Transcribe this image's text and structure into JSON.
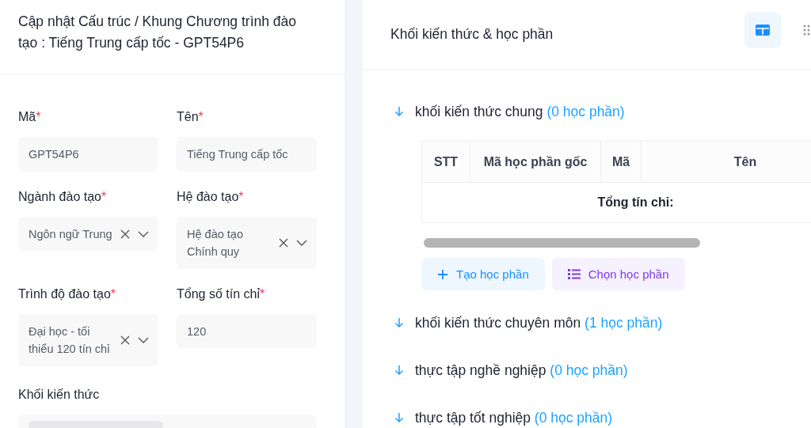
{
  "form": {
    "title": "Cập nhật Cấu trúc / Khung Chương trình đào tạo : Tiếng Trung cấp tốc - GPT54P6",
    "fields": [
      {
        "label": "Mã",
        "required_mark": "*",
        "kind": "text",
        "value": "GPT54P6"
      },
      {
        "label": "Tên",
        "required_mark": "*",
        "kind": "text",
        "value": "Tiếng Trung cấp tốc"
      },
      {
        "label": "Ngành đào tạo",
        "required_mark": "*",
        "kind": "select",
        "value": "Ngôn ngữ Trung"
      },
      {
        "label": "Hệ đào tạo",
        "required_mark": "*",
        "kind": "select",
        "value": "Hệ đào tạo Chính quy"
      },
      {
        "label": "Trình độ đào tạo",
        "required_mark": "*",
        "kind": "select",
        "value": "Đại học - tối thiểu 120 tín chỉ"
      },
      {
        "label": "Tổng số tín chỉ",
        "required_mark": "*",
        "kind": "text",
        "value": "120"
      },
      {
        "label": "Khối kiến thức",
        "kind": "tags"
      }
    ]
  },
  "panel": {
    "title": "Khối kiến thức & học phần",
    "view_buttons": [
      {
        "kind": "table",
        "selected": true
      },
      {
        "kind": "grid",
        "selected": false
      }
    ],
    "sections": [
      {
        "name": "khối kiến thức chung",
        "count": "(0 học phần)",
        "expanded": true,
        "table": {
          "columns": [
            "STT",
            "Mã học phần gốc",
            "Mã",
            "Tên"
          ],
          "footer": "Tổng tín chỉ:"
        },
        "buttons": [
          {
            "kind": "create",
            "label": "Tạo học phần"
          },
          {
            "kind": "choose",
            "label": "Chọn học phần"
          }
        ]
      },
      {
        "name": "khối kiến thức chuyên môn",
        "count": "(1 học phần)",
        "expanded": false
      },
      {
        "name": "thực tập nghề nghiệp",
        "count": "(0 học phần)",
        "expanded": false
      },
      {
        "name": "thực tập tốt nghiệp",
        "count": "(0 học phần)",
        "expanded": false
      }
    ]
  }
}
